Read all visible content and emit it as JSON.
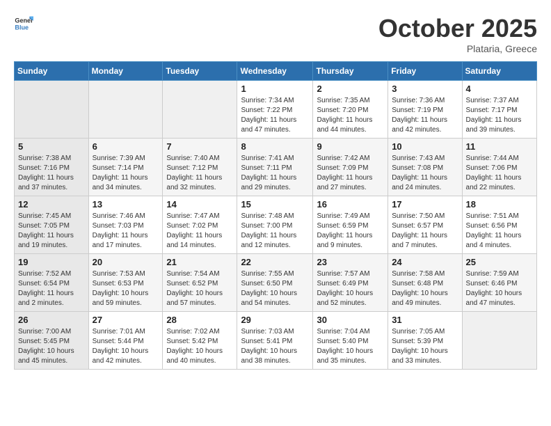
{
  "header": {
    "logo_general": "General",
    "logo_blue": "Blue",
    "month": "October 2025",
    "location": "Plataria, Greece"
  },
  "weekdays": [
    "Sunday",
    "Monday",
    "Tuesday",
    "Wednesday",
    "Thursday",
    "Friday",
    "Saturday"
  ],
  "weeks": [
    [
      {
        "day": "",
        "info": ""
      },
      {
        "day": "",
        "info": ""
      },
      {
        "day": "",
        "info": ""
      },
      {
        "day": "1",
        "info": "Sunrise: 7:34 AM\nSunset: 7:22 PM\nDaylight: 11 hours and 47 minutes."
      },
      {
        "day": "2",
        "info": "Sunrise: 7:35 AM\nSunset: 7:20 PM\nDaylight: 11 hours and 44 minutes."
      },
      {
        "day": "3",
        "info": "Sunrise: 7:36 AM\nSunset: 7:19 PM\nDaylight: 11 hours and 42 minutes."
      },
      {
        "day": "4",
        "info": "Sunrise: 7:37 AM\nSunset: 7:17 PM\nDaylight: 11 hours and 39 minutes."
      }
    ],
    [
      {
        "day": "5",
        "info": "Sunrise: 7:38 AM\nSunset: 7:16 PM\nDaylight: 11 hours and 37 minutes."
      },
      {
        "day": "6",
        "info": "Sunrise: 7:39 AM\nSunset: 7:14 PM\nDaylight: 11 hours and 34 minutes."
      },
      {
        "day": "7",
        "info": "Sunrise: 7:40 AM\nSunset: 7:12 PM\nDaylight: 11 hours and 32 minutes."
      },
      {
        "day": "8",
        "info": "Sunrise: 7:41 AM\nSunset: 7:11 PM\nDaylight: 11 hours and 29 minutes."
      },
      {
        "day": "9",
        "info": "Sunrise: 7:42 AM\nSunset: 7:09 PM\nDaylight: 11 hours and 27 minutes."
      },
      {
        "day": "10",
        "info": "Sunrise: 7:43 AM\nSunset: 7:08 PM\nDaylight: 11 hours and 24 minutes."
      },
      {
        "day": "11",
        "info": "Sunrise: 7:44 AM\nSunset: 7:06 PM\nDaylight: 11 hours and 22 minutes."
      }
    ],
    [
      {
        "day": "12",
        "info": "Sunrise: 7:45 AM\nSunset: 7:05 PM\nDaylight: 11 hours and 19 minutes."
      },
      {
        "day": "13",
        "info": "Sunrise: 7:46 AM\nSunset: 7:03 PM\nDaylight: 11 hours and 17 minutes."
      },
      {
        "day": "14",
        "info": "Sunrise: 7:47 AM\nSunset: 7:02 PM\nDaylight: 11 hours and 14 minutes."
      },
      {
        "day": "15",
        "info": "Sunrise: 7:48 AM\nSunset: 7:00 PM\nDaylight: 11 hours and 12 minutes."
      },
      {
        "day": "16",
        "info": "Sunrise: 7:49 AM\nSunset: 6:59 PM\nDaylight: 11 hours and 9 minutes."
      },
      {
        "day": "17",
        "info": "Sunrise: 7:50 AM\nSunset: 6:57 PM\nDaylight: 11 hours and 7 minutes."
      },
      {
        "day": "18",
        "info": "Sunrise: 7:51 AM\nSunset: 6:56 PM\nDaylight: 11 hours and 4 minutes."
      }
    ],
    [
      {
        "day": "19",
        "info": "Sunrise: 7:52 AM\nSunset: 6:54 PM\nDaylight: 11 hours and 2 minutes."
      },
      {
        "day": "20",
        "info": "Sunrise: 7:53 AM\nSunset: 6:53 PM\nDaylight: 10 hours and 59 minutes."
      },
      {
        "day": "21",
        "info": "Sunrise: 7:54 AM\nSunset: 6:52 PM\nDaylight: 10 hours and 57 minutes."
      },
      {
        "day": "22",
        "info": "Sunrise: 7:55 AM\nSunset: 6:50 PM\nDaylight: 10 hours and 54 minutes."
      },
      {
        "day": "23",
        "info": "Sunrise: 7:57 AM\nSunset: 6:49 PM\nDaylight: 10 hours and 52 minutes."
      },
      {
        "day": "24",
        "info": "Sunrise: 7:58 AM\nSunset: 6:48 PM\nDaylight: 10 hours and 49 minutes."
      },
      {
        "day": "25",
        "info": "Sunrise: 7:59 AM\nSunset: 6:46 PM\nDaylight: 10 hours and 47 minutes."
      }
    ],
    [
      {
        "day": "26",
        "info": "Sunrise: 7:00 AM\nSunset: 5:45 PM\nDaylight: 10 hours and 45 minutes."
      },
      {
        "day": "27",
        "info": "Sunrise: 7:01 AM\nSunset: 5:44 PM\nDaylight: 10 hours and 42 minutes."
      },
      {
        "day": "28",
        "info": "Sunrise: 7:02 AM\nSunset: 5:42 PM\nDaylight: 10 hours and 40 minutes."
      },
      {
        "day": "29",
        "info": "Sunrise: 7:03 AM\nSunset: 5:41 PM\nDaylight: 10 hours and 38 minutes."
      },
      {
        "day": "30",
        "info": "Sunrise: 7:04 AM\nSunset: 5:40 PM\nDaylight: 10 hours and 35 minutes."
      },
      {
        "day": "31",
        "info": "Sunrise: 7:05 AM\nSunset: 5:39 PM\nDaylight: 10 hours and 33 minutes."
      },
      {
        "day": "",
        "info": ""
      }
    ]
  ]
}
